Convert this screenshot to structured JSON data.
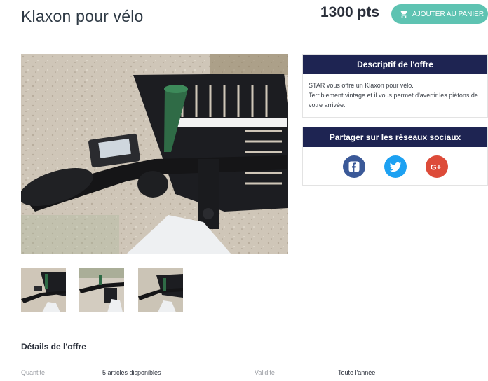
{
  "product": {
    "title": "Klaxon pour vélo",
    "points": "1300 pts",
    "add_to_cart_label": "AJOUTER AU PANIER"
  },
  "description_panel": {
    "heading": "Descriptif de l'offre",
    "line1": "STAR vous offre un Klaxon pour vélo.",
    "line2": "Terriblement vintage et il vous permet d'avertir les piétons de votre arrivée."
  },
  "share_panel": {
    "heading": "Partager sur les réseaux sociaux",
    "networks": [
      "facebook-icon",
      "twitter-icon",
      "google-plus-icon"
    ],
    "colors": {
      "facebook": "#3b5998",
      "twitter": "#1da1f2",
      "google_plus": "#dd4b39"
    }
  },
  "details": {
    "heading": "Détails de l'offre",
    "quantity_label": "Quantité",
    "quantity_value": "5 articles disponibles",
    "validity_label": "Validité",
    "validity_value": "Toute l'année"
  },
  "colors": {
    "accent": "#5ec3b2",
    "panel_header": "#1e2452"
  }
}
